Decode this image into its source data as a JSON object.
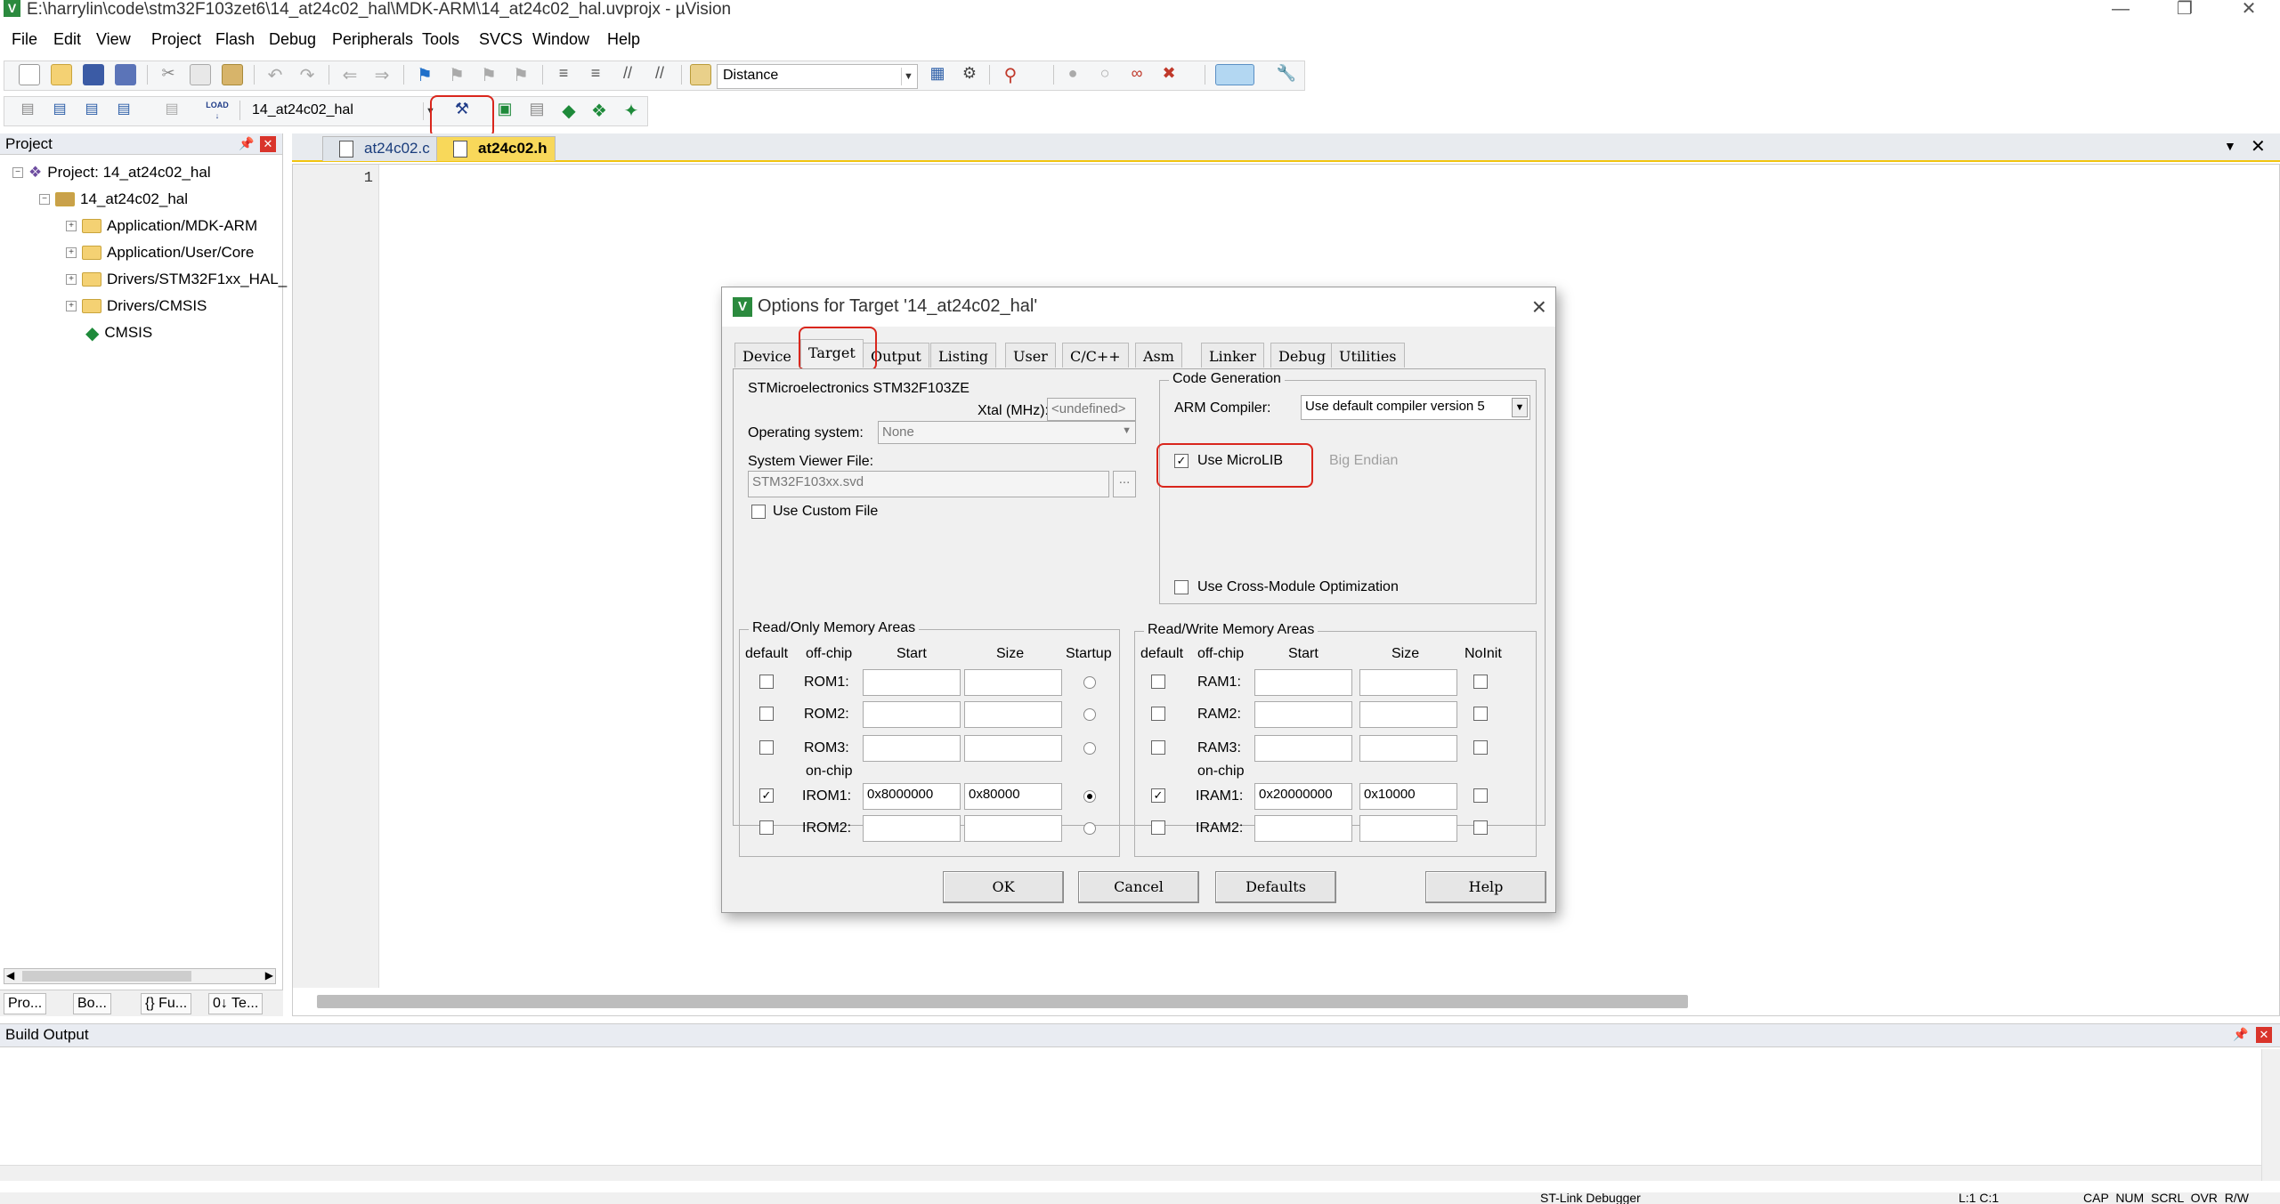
{
  "window": {
    "title": "E:\\harrylin\\code\\stm32F103zet6\\14_at24c02_hal\\MDK-ARM\\14_at24c02_hal.uvprojx - µVision",
    "app_icon": "V"
  },
  "menubar": [
    "File",
    "Edit",
    "View",
    "Project",
    "Flash",
    "Debug",
    "Peripherals",
    "Tools",
    "SVCS",
    "Window",
    "Help"
  ],
  "toolbar": {
    "find_combo_value": "Distance",
    "target_combo_value": "14_at24c02_hal",
    "load_label": "LOAD"
  },
  "project_panel": {
    "title": "Project",
    "tree": [
      {
        "label": "Project: 14_at24c02_hal"
      },
      {
        "label": "14_at24c02_hal"
      },
      {
        "label": "Application/MDK-ARM"
      },
      {
        "label": "Application/User/Core"
      },
      {
        "label": "Drivers/STM32F1xx_HAL_"
      },
      {
        "label": "Drivers/CMSIS"
      },
      {
        "label": "CMSIS"
      }
    ],
    "bottom_tabs": [
      "Pro...",
      "Bo...",
      "{} Fu...",
      "0↓ Te..."
    ]
  },
  "editor": {
    "tabs": [
      {
        "label": "at24c02.c",
        "active": false
      },
      {
        "label": "at24c02.h",
        "active": true
      }
    ],
    "line_number": "1"
  },
  "dialog": {
    "title": "Options for Target '14_at24c02_hal'",
    "icon": "V",
    "tabs": [
      "Device",
      "Target",
      "Output",
      "Listing",
      "User",
      "C/C++",
      "Asm",
      "Linker",
      "Debug",
      "Utilities"
    ],
    "active_tab": "Target",
    "device_name": "STMicroelectronics STM32F103ZE",
    "xtal_label": "Xtal (MHz):",
    "xtal_value": "<undefined>",
    "os_label": "Operating system:",
    "os_value": "None",
    "svd_label": "System Viewer File:",
    "svd_value": "STM32F103xx.svd",
    "browse_label": "...",
    "use_custom_file_label": "Use Custom File",
    "use_custom_file_checked": false,
    "code_generation": {
      "caption": "Code Generation",
      "arm_compiler_label": "ARM Compiler:",
      "arm_compiler_value": "Use default compiler version 5",
      "use_microlib_label": "Use MicroLIB",
      "use_microlib_checked": true,
      "big_endian_label": "Big Endian",
      "cross_module_label": "Use Cross-Module Optimization",
      "cross_module_checked": false
    },
    "ro_memory": {
      "caption": "Read/Only Memory Areas",
      "headers": [
        "default",
        "off-chip",
        "Start",
        "Size",
        "Startup"
      ],
      "on_chip_label": "on-chip",
      "rows": [
        {
          "name": "ROM1:",
          "default": false,
          "start": "",
          "size": "",
          "startup": false
        },
        {
          "name": "ROM2:",
          "default": false,
          "start": "",
          "size": "",
          "startup": false
        },
        {
          "name": "ROM3:",
          "default": false,
          "start": "",
          "size": "",
          "startup": false
        },
        {
          "name": "IROM1:",
          "default": true,
          "start": "0x8000000",
          "size": "0x80000",
          "startup": true
        },
        {
          "name": "IROM2:",
          "default": false,
          "start": "",
          "size": "",
          "startup": false
        }
      ]
    },
    "rw_memory": {
      "caption": "Read/Write Memory Areas",
      "headers": [
        "default",
        "off-chip",
        "Start",
        "Size",
        "NoInit"
      ],
      "on_chip_label": "on-chip",
      "rows": [
        {
          "name": "RAM1:",
          "default": false,
          "start": "",
          "size": "",
          "noinit": false
        },
        {
          "name": "RAM2:",
          "default": false,
          "start": "",
          "size": "",
          "noinit": false
        },
        {
          "name": "RAM3:",
          "default": false,
          "start": "",
          "size": "",
          "noinit": false
        },
        {
          "name": "IRAM1:",
          "default": true,
          "start": "0x20000000",
          "size": "0x10000",
          "noinit": false
        },
        {
          "name": "IRAM2:",
          "default": false,
          "start": "",
          "size": "",
          "noinit": false
        }
      ]
    },
    "buttons": {
      "ok": "OK",
      "cancel": "Cancel",
      "defaults": "Defaults",
      "help": "Help"
    }
  },
  "build_output": {
    "title": "Build Output"
  },
  "statusbar": {
    "debugger": "ST-Link Debugger",
    "position": "L:1 C:1",
    "indicators": "CAP  NUM  SCRL  OVR  R/W"
  },
  "colors": {
    "highlight_red": "#d9261c",
    "active_tab_yellow": "#f8d85a",
    "close_red": "#d9342b"
  }
}
